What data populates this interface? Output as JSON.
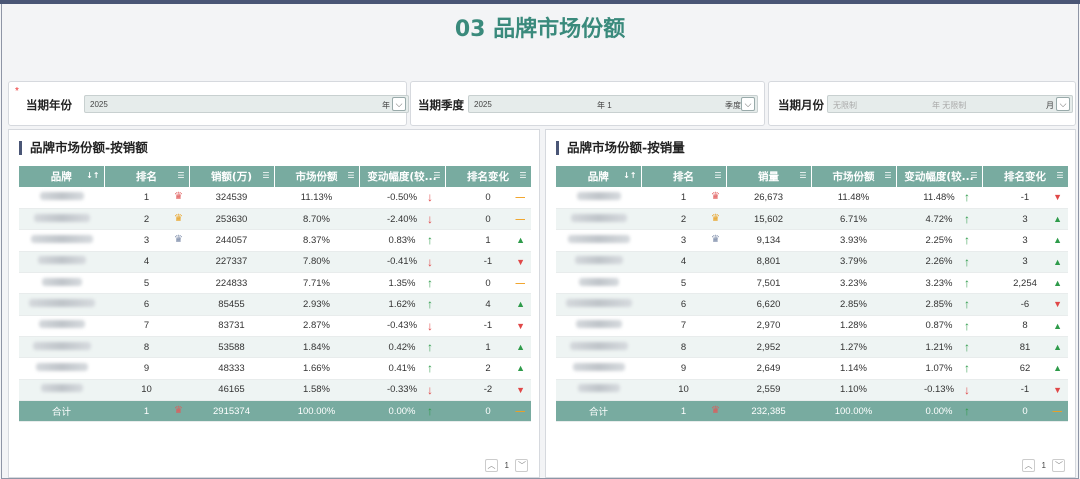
{
  "page": {
    "title": "03 品牌市场份额"
  },
  "filters": [
    {
      "label": "当期年份",
      "required": true,
      "value": "2025",
      "middle": "",
      "unit": "年"
    },
    {
      "label": "当期季度",
      "required": false,
      "value": "2025",
      "middle": "年 1",
      "unit": "季度"
    },
    {
      "label": "当期月份",
      "required": false,
      "placeholder": "无限制",
      "middle": "年 无限制",
      "unit": "月"
    }
  ],
  "panels": [
    {
      "title": "品牌市场份额-按销额",
      "columns": [
        "品牌",
        "排名",
        "销额(万)",
        "市场份额",
        "变动幅度(较...",
        "排名变化"
      ],
      "rows": [
        {
          "rank": "1",
          "crown": "red",
          "value": "324539",
          "share": "11.13%",
          "change": "-0.50%",
          "dir": "down",
          "rchange": "0",
          "rmark": "dash"
        },
        {
          "rank": "2",
          "crown": "gold",
          "value": "253630",
          "share": "8.70%",
          "change": "-2.40%",
          "dir": "down",
          "rchange": "0",
          "rmark": "dash"
        },
        {
          "rank": "3",
          "crown": "blue",
          "value": "244057",
          "share": "8.37%",
          "change": "0.83%",
          "dir": "up",
          "rchange": "1",
          "rmark": "up"
        },
        {
          "rank": "4",
          "crown": "",
          "value": "227337",
          "share": "7.80%",
          "change": "-0.41%",
          "dir": "down",
          "rchange": "-1",
          "rmark": "down"
        },
        {
          "rank": "5",
          "crown": "",
          "value": "224833",
          "share": "7.71%",
          "change": "1.35%",
          "dir": "up",
          "rchange": "0",
          "rmark": "dash"
        },
        {
          "rank": "6",
          "crown": "",
          "value": "85455",
          "share": "2.93%",
          "change": "1.62%",
          "dir": "up",
          "rchange": "4",
          "rmark": "up"
        },
        {
          "rank": "7",
          "crown": "",
          "value": "83731",
          "share": "2.87%",
          "change": "-0.43%",
          "dir": "down",
          "rchange": "-1",
          "rmark": "down"
        },
        {
          "rank": "8",
          "crown": "",
          "value": "53588",
          "share": "1.84%",
          "change": "0.42%",
          "dir": "up",
          "rchange": "1",
          "rmark": "up"
        },
        {
          "rank": "9",
          "crown": "",
          "value": "48333",
          "share": "1.66%",
          "change": "0.41%",
          "dir": "up",
          "rchange": "2",
          "rmark": "up"
        },
        {
          "rank": "10",
          "crown": "",
          "value": "46165",
          "share": "1.58%",
          "change": "-0.33%",
          "dir": "down",
          "rchange": "-2",
          "rmark": "down"
        }
      ],
      "total": {
        "label": "合计",
        "rank": "1",
        "crown": "red",
        "value": "2915374",
        "share": "100.00%",
        "change": "0.00%",
        "dir": "up",
        "rchange": "0",
        "rmark": "dash"
      },
      "pager": {
        "page": "1"
      }
    },
    {
      "title": "品牌市场份额-按销量",
      "columns": [
        "品牌",
        "排名",
        "销量",
        "市场份额",
        "变动幅度(较...",
        "排名变化"
      ],
      "rows": [
        {
          "rank": "1",
          "crown": "red",
          "value": "26,673",
          "share": "11.48%",
          "change": "11.48%",
          "dir": "up",
          "rchange": "-1",
          "rmark": "down"
        },
        {
          "rank": "2",
          "crown": "gold",
          "value": "15,602",
          "share": "6.71%",
          "change": "4.72%",
          "dir": "up",
          "rchange": "3",
          "rmark": "up"
        },
        {
          "rank": "3",
          "crown": "blue",
          "value": "9,134",
          "share": "3.93%",
          "change": "2.25%",
          "dir": "up",
          "rchange": "3",
          "rmark": "up"
        },
        {
          "rank": "4",
          "crown": "",
          "value": "8,801",
          "share": "3.79%",
          "change": "2.26%",
          "dir": "up",
          "rchange": "3",
          "rmark": "up"
        },
        {
          "rank": "5",
          "crown": "",
          "value": "7,501",
          "share": "3.23%",
          "change": "3.23%",
          "dir": "up",
          "rchange": "2,254",
          "rmark": "up"
        },
        {
          "rank": "6",
          "crown": "",
          "value": "6,620",
          "share": "2.85%",
          "change": "2.85%",
          "dir": "up",
          "rchange": "-6",
          "rmark": "down"
        },
        {
          "rank": "7",
          "crown": "",
          "value": "2,970",
          "share": "1.28%",
          "change": "0.87%",
          "dir": "up",
          "rchange": "8",
          "rmark": "up"
        },
        {
          "rank": "8",
          "crown": "",
          "value": "2,952",
          "share": "1.27%",
          "change": "1.21%",
          "dir": "up",
          "rchange": "81",
          "rmark": "up"
        },
        {
          "rank": "9",
          "crown": "",
          "value": "2,649",
          "share": "1.14%",
          "change": "1.07%",
          "dir": "up",
          "rchange": "62",
          "rmark": "up"
        },
        {
          "rank": "10",
          "crown": "",
          "value": "2,559",
          "share": "1.10%",
          "change": "-0.13%",
          "dir": "down",
          "rchange": "-1",
          "rmark": "down"
        }
      ],
      "total": {
        "label": "合计",
        "rank": "1",
        "crown": "red",
        "value": "232,385",
        "share": "100.00%",
        "change": "0.00%",
        "dir": "up",
        "rchange": "0",
        "rmark": "dash"
      },
      "pager": {
        "page": "1"
      }
    }
  ],
  "colors": {
    "accent": "#3a8a7c",
    "header": "#78aba0",
    "up": "#2e9b4a",
    "down": "#e04848",
    "flat": "#f0a020",
    "crown_red": "#e05a5a",
    "crown_gold": "#e8a020",
    "crown_blue": "#7a8aa8"
  },
  "icons": {
    "sort": "sort-icon",
    "crown": "crown-icon",
    "up": "arrow-up-icon",
    "down": "arrow-down-icon",
    "dropdown": "chevron-down-icon"
  }
}
